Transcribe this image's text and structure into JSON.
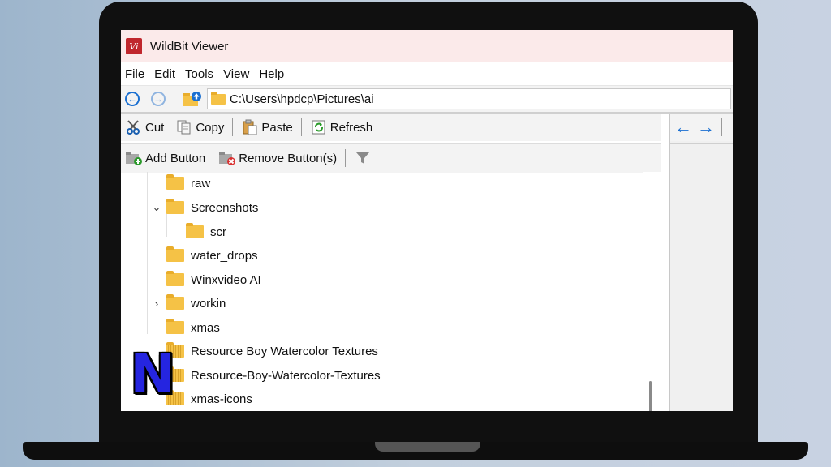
{
  "window": {
    "title": "WildBit Viewer",
    "app_icon_text": "Vi"
  },
  "menu": [
    "File",
    "Edit",
    "Tools",
    "View",
    "Help"
  ],
  "address": {
    "path": "C:\\Users\\hpdcp\\Pictures\\ai"
  },
  "toolbar1": {
    "cut": "Cut",
    "copy": "Copy",
    "paste": "Paste",
    "refresh": "Refresh"
  },
  "toolbar2": {
    "add_button": "Add Button",
    "remove_button": "Remove Button(s)"
  },
  "tree": [
    {
      "label": "raw",
      "expander": ""
    },
    {
      "label": "Screenshots",
      "expander": "⌄"
    },
    {
      "label": "scr",
      "expander": ""
    },
    {
      "label": "water_drops",
      "expander": ""
    },
    {
      "label": "Winxvideo AI",
      "expander": ""
    },
    {
      "label": "workin",
      "expander": "›"
    },
    {
      "label": "xmas",
      "expander": ""
    },
    {
      "label": "Resource Boy Watercolor Textures",
      "expander": ""
    },
    {
      "label": "Resource-Boy-Watercolor-Textures",
      "expander": ""
    },
    {
      "label": "xmas-icons",
      "expander": ""
    }
  ],
  "right_pane": {
    "back_arrow": "←",
    "forward_arrow": "→"
  },
  "overlay": {
    "logo_letter": "N",
    "logo_color": "#2525e0"
  },
  "colors": {
    "accent": "#1a6fd1",
    "folder": "#f5c246",
    "titlebar": "#fbeaea"
  }
}
